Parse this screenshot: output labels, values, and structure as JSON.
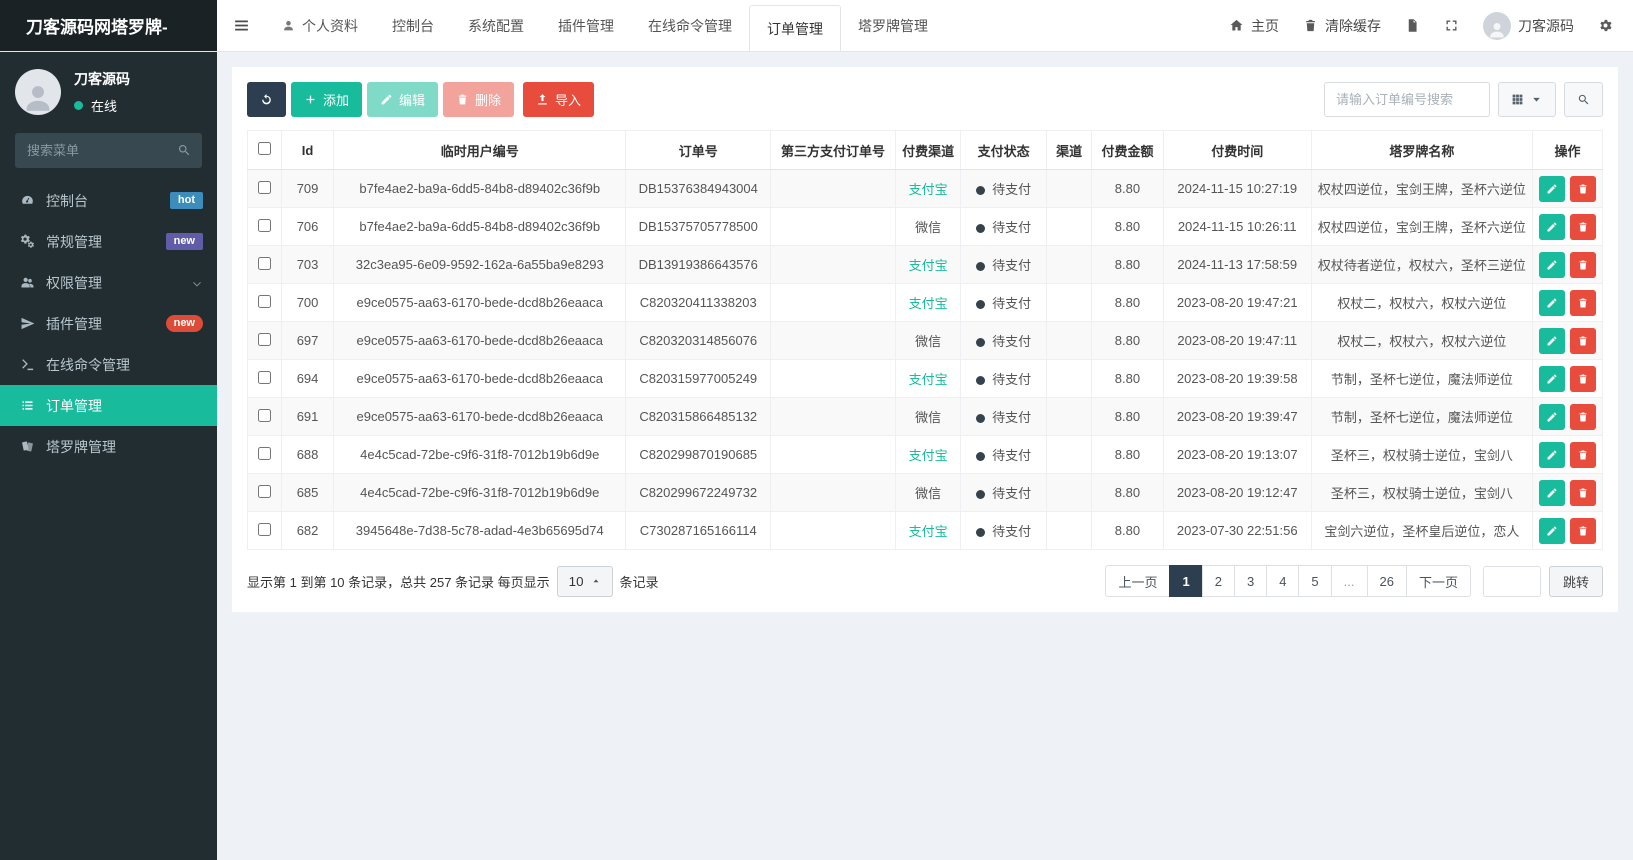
{
  "brand": "刀客源码网塔罗牌-",
  "topbar": {
    "tabs": [
      {
        "label": "个人资料",
        "icon": "user"
      },
      {
        "label": "控制台"
      },
      {
        "label": "系统配置"
      },
      {
        "label": "插件管理"
      },
      {
        "label": "在线命令管理"
      },
      {
        "label": "订单管理"
      },
      {
        "label": "塔罗牌管理"
      }
    ],
    "active_tab": "订单管理",
    "right": {
      "home": "主页",
      "clear_cache": "清除缓存",
      "username": "刀客源码"
    }
  },
  "sidebar": {
    "user": {
      "name": "刀客源码",
      "status": "在线"
    },
    "search_placeholder": "搜索菜单",
    "menu": [
      {
        "label": "控制台",
        "icon": "dashboard",
        "badge": "hot",
        "badge_color": "#3c8dbc"
      },
      {
        "label": "常规管理",
        "icon": "gears",
        "badge": "new",
        "badge_color": "#605ca8"
      },
      {
        "label": "权限管理",
        "icon": "users",
        "chevron": true
      },
      {
        "label": "插件管理",
        "icon": "rocket",
        "badge": "new",
        "badge_color": "#dd4b39",
        "badge_pill": true
      },
      {
        "label": "在线命令管理",
        "icon": "terminal"
      },
      {
        "label": "订单管理",
        "icon": "list",
        "active": true
      },
      {
        "label": "塔罗牌管理",
        "icon": "cards"
      }
    ]
  },
  "toolbar": {
    "add": "添加",
    "edit": "编辑",
    "delete": "删除",
    "import": "导入",
    "search_placeholder": "请输入订单编号搜索"
  },
  "table": {
    "columns": [
      "Id",
      "临时用户编号",
      "订单号",
      "第三方支付订单号",
      "付费渠道",
      "支付状态",
      "渠道",
      "付费金额",
      "付费时间",
      "塔罗牌名称",
      "操作"
    ],
    "rows": [
      {
        "id": "709",
        "user": "b7fe4ae2-ba9a-6dd5-84b8-d89402c36f9b",
        "order": "DB15376384943004",
        "third": "",
        "channel": "支付宝",
        "channel_type": "alipay",
        "status": "待支付",
        "qudao": "",
        "amount": "8.80",
        "time": "2024-11-15 10:27:19",
        "tarot": "权杖四逆位，宝剑王牌，圣杯六逆位"
      },
      {
        "id": "706",
        "user": "b7fe4ae2-ba9a-6dd5-84b8-d89402c36f9b",
        "order": "DB15375705778500",
        "third": "",
        "channel": "微信",
        "channel_type": "wechat",
        "status": "待支付",
        "qudao": "",
        "amount": "8.80",
        "time": "2024-11-15 10:26:11",
        "tarot": "权杖四逆位，宝剑王牌，圣杯六逆位"
      },
      {
        "id": "703",
        "user": "32c3ea95-6e09-9592-162a-6a55ba9e8293",
        "order": "DB13919386643576",
        "third": "",
        "channel": "支付宝",
        "channel_type": "alipay",
        "status": "待支付",
        "qudao": "",
        "amount": "8.80",
        "time": "2024-11-13 17:58:59",
        "tarot": "权杖待者逆位，权杖六，圣杯三逆位"
      },
      {
        "id": "700",
        "user": "e9ce0575-aa63-6170-bede-dcd8b26eaaca",
        "order": "C820320411338203",
        "third": "",
        "channel": "支付宝",
        "channel_type": "alipay",
        "status": "待支付",
        "qudao": "",
        "amount": "8.80",
        "time": "2023-08-20 19:47:21",
        "tarot": "权杖二，权杖六，权杖六逆位"
      },
      {
        "id": "697",
        "user": "e9ce0575-aa63-6170-bede-dcd8b26eaaca",
        "order": "C820320314856076",
        "third": "",
        "channel": "微信",
        "channel_type": "wechat",
        "status": "待支付",
        "qudao": "",
        "amount": "8.80",
        "time": "2023-08-20 19:47:11",
        "tarot": "权杖二，权杖六，权杖六逆位"
      },
      {
        "id": "694",
        "user": "e9ce0575-aa63-6170-bede-dcd8b26eaaca",
        "order": "C820315977005249",
        "third": "",
        "channel": "支付宝",
        "channel_type": "alipay",
        "status": "待支付",
        "qudao": "",
        "amount": "8.80",
        "time": "2023-08-20 19:39:58",
        "tarot": "节制，圣杯七逆位，魔法师逆位"
      },
      {
        "id": "691",
        "user": "e9ce0575-aa63-6170-bede-dcd8b26eaaca",
        "order": "C820315866485132",
        "third": "",
        "channel": "微信",
        "channel_type": "wechat",
        "status": "待支付",
        "qudao": "",
        "amount": "8.80",
        "time": "2023-08-20 19:39:47",
        "tarot": "节制，圣杯七逆位，魔法师逆位"
      },
      {
        "id": "688",
        "user": "4e4c5cad-72be-c9f6-31f8-7012b19b6d9e",
        "order": "C820299870190685",
        "third": "",
        "channel": "支付宝",
        "channel_type": "alipay",
        "status": "待支付",
        "qudao": "",
        "amount": "8.80",
        "time": "2023-08-20 19:13:07",
        "tarot": "圣杯三，权杖骑士逆位，宝剑八"
      },
      {
        "id": "685",
        "user": "4e4c5cad-72be-c9f6-31f8-7012b19b6d9e",
        "order": "C820299672249732",
        "third": "",
        "channel": "微信",
        "channel_type": "wechat",
        "status": "待支付",
        "qudao": "",
        "amount": "8.80",
        "time": "2023-08-20 19:12:47",
        "tarot": "圣杯三，权杖骑士逆位，宝剑八"
      },
      {
        "id": "682",
        "user": "3945648e-7d38-5c78-adad-4e3b65695d74",
        "order": "C730287165166114",
        "third": "",
        "channel": "支付宝",
        "channel_type": "alipay",
        "status": "待支付",
        "qudao": "",
        "amount": "8.80",
        "time": "2023-07-30 22:51:56",
        "tarot": "宝剑六逆位，圣杯皇后逆位，恋人"
      }
    ]
  },
  "pagination": {
    "summary_prefix": "显示第 1 到第 10 条记录，总共 257 条记录 每页显示",
    "page_size": "10",
    "summary_suffix": "条记录",
    "prev": "上一页",
    "next": "下一页",
    "pages": [
      "1",
      "2",
      "3",
      "4",
      "5",
      "...",
      "26"
    ],
    "active_page": "1",
    "jump": "跳转"
  },
  "colors": {
    "accent_teal": "#18bc9c",
    "danger_red": "#e74c3c",
    "navy": "#2c3e50",
    "badge_hot_blue": "#3c8dbc",
    "badge_new_purple": "#605ca8",
    "badge_new_red": "#dd4b39",
    "sidebar_dark": "#222d32",
    "status_dot": "#36424c"
  }
}
